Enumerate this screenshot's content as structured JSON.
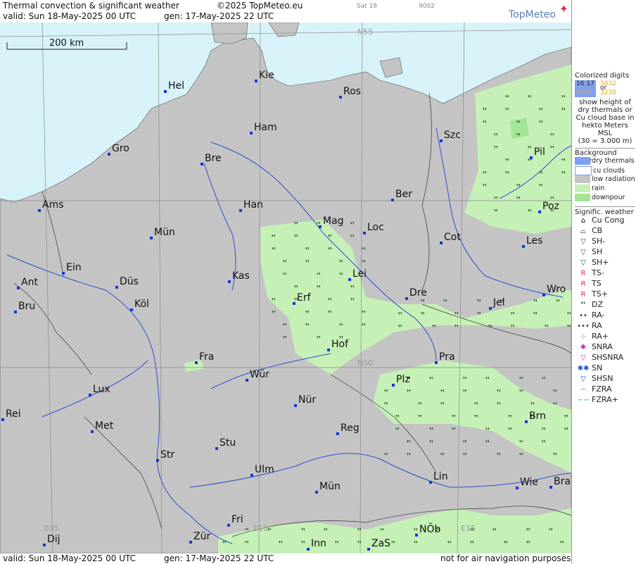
{
  "header": {
    "title": "Thermal convection & significant weather",
    "copyright": "©2025 TopMeteo.eu",
    "day": "Sat 18",
    "code": "9002",
    "logo": "TopMeteo",
    "valid": "valid:  Sun  18-May-2025  00 UTC",
    "gen": "gen: 17-May-2025 22 UTC"
  },
  "footer": {
    "valid": "valid:  Sun  18-May-2025  00 UTC",
    "gen": "gen: 17-May-2025 22 UTC",
    "note": "not for air navigation purposes"
  },
  "map": {
    "scale_label": "200 km",
    "grid_labels": [
      "N55",
      "N50",
      "E05",
      "E10",
      "E15"
    ],
    "cities": [
      "Hel",
      "Kie",
      "Ros",
      "Ham",
      "Gro",
      "Bre",
      "Szc",
      "Pil",
      "Ber",
      "Ams",
      "Han",
      "Mag",
      "Loc",
      "Poz",
      "Mün",
      "Cot",
      "Les",
      "Ein",
      "Kas",
      "Lei",
      "Ant",
      "Düs",
      "Wro",
      "Erf",
      "Dre",
      "Jel",
      "Bru",
      "Köl",
      "Hof",
      "Fra",
      "Pra",
      "Würz",
      "Plz",
      "Lux",
      "Nür",
      "Rei",
      "Met",
      "Reg",
      "Brn",
      "Stu",
      "Str",
      "Ulm",
      "Lin",
      "Wie",
      "Bra",
      "Mün2",
      "Fri",
      "NÖb",
      "Dij",
      "Zür",
      "Inn",
      "ZaS"
    ],
    "city_names": {
      "Hel": "Hel",
      "Kie": "Kie",
      "Ros": "Ros",
      "Ham": "Ham",
      "Gro": "Gro",
      "Bre": "Bre",
      "Szc": "Szc",
      "Pil": "Pil",
      "Ber": "Ber",
      "Ams": "Ams",
      "Han": "Han",
      "Mag": "Mag",
      "Loc": "Loc",
      "Poz": "Poz",
      "Mün": "Mün",
      "Cot": "Cot",
      "Les": "Les",
      "Ein": "Ein",
      "Kas": "Kas",
      "Lei": "Lei",
      "Ant": "Ant",
      "Düs": "Düs",
      "Wro": "Wro",
      "Erf": "Erf",
      "Dre": "Dre",
      "Jel": "Jel",
      "Bru": "Bru",
      "Köl": "Köl",
      "Hof": "Hof",
      "Fra": "Fra",
      "Pra": "Pra",
      "Würz": "Wür",
      "Plz": "Plz",
      "Lux": "Lux",
      "Nür": "Nür",
      "Rei": "Rei",
      "Met": "Met",
      "Reg": "Reg",
      "Brn": "Brn",
      "Stu": "Stu",
      "Str": "Str",
      "Ulm": "Ulm",
      "Lin": "Lin",
      "Wie": "Wie",
      "Bra": "Bra",
      "Mün2": "Mün",
      "Fri": "Fri",
      "NÖb": "NÖb",
      "Dij": "Dij",
      "Zür": "Zür",
      "Inn": "Inn",
      "ZaS": "ZaS"
    },
    "colors": {
      "sea": "#d8f2f9",
      "land": "#c4c4c4",
      "rain": "#c6f0b6",
      "downpour": "#a4e496",
      "river": "#2a4ecf",
      "grid": "#8a8a8a",
      "border": "#333333"
    }
  },
  "legend": {
    "colorized": "Colorized digits",
    "sample1a": "16 17",
    "sample1b": "3032",
    "or": "or",
    "sample2a": "2828",
    "sample2b": "3230",
    "desc": "show height of dry thermals or Cu cloud base in hekto Meters MSL",
    "desc_example": "(30 = 3.000 m)",
    "bg_title": "Background color",
    "bg_items": [
      "dry thermals",
      "cu clouds",
      "low radiation",
      "rain",
      "downpour"
    ],
    "bg_colors": [
      "#7f9ff0",
      "#ffffff",
      "#c4c4c4",
      "#c6f0b6",
      "#a4e496"
    ],
    "sig_title": "Signific. weather",
    "sig_items": [
      "Cu Cong",
      "CB",
      "SH-",
      "SH",
      "SH+",
      "TS-",
      "TS",
      "TS+",
      "DZ",
      "RA-",
      "RA",
      "RA+",
      "SNRA",
      "SHSNRA",
      "SN",
      "SHSN",
      "FZRA",
      "FZRA+"
    ],
    "sig_symbols": [
      "⌂",
      "⌓",
      "▽",
      "▽",
      "▽",
      "R",
      "R",
      "R",
      "❜❜",
      "••",
      "•••",
      "⁘",
      "✱",
      "▽",
      "✱✱",
      "▽",
      "∽",
      "∽∽"
    ],
    "sig_colors": [
      "#000000",
      "#000000",
      "#0a7a0a",
      "#0a7a0a",
      "#0a7a0a",
      "#d33",
      "#d33",
      "#d33",
      "#0a5a0a",
      "#0a5a0a",
      "#0a5a0a",
      "#0a5a0a",
      "#c2c",
      "#c2c",
      "#2a4ecf",
      "#2a4ecf",
      "#1ac",
      "#1ac"
    ]
  }
}
